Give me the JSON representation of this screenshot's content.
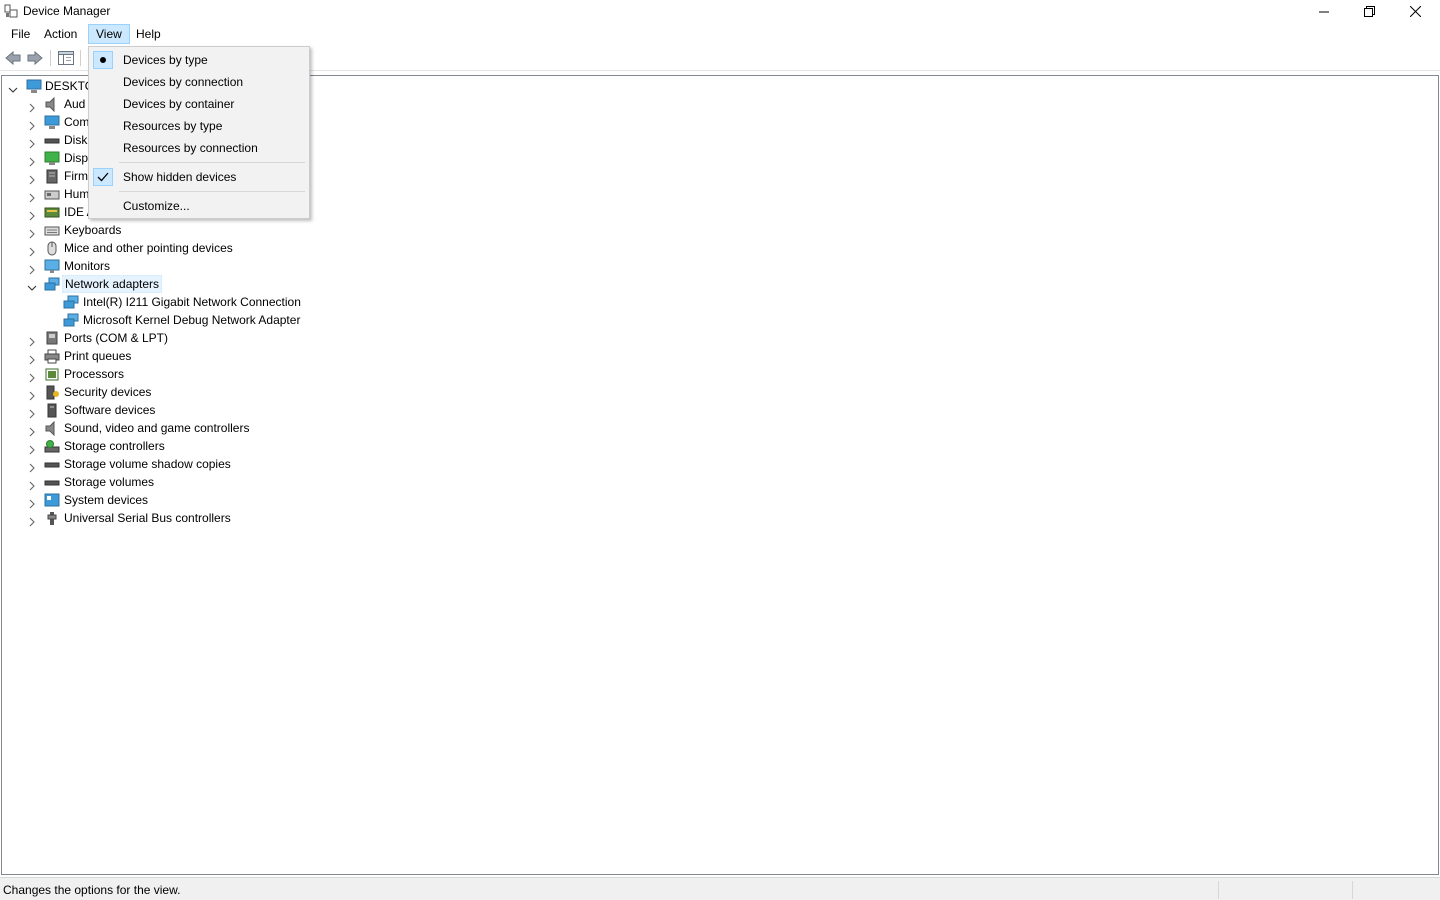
{
  "window": {
    "title": "Device Manager",
    "icon": "device-manager-icon"
  },
  "menubar": {
    "items": [
      "File",
      "Action",
      "View",
      "Help"
    ],
    "active": "View"
  },
  "view_menu": {
    "items": [
      {
        "label": "Devices by type",
        "mark": "radio"
      },
      {
        "label": "Devices by connection",
        "mark": ""
      },
      {
        "label": "Devices by container",
        "mark": ""
      },
      {
        "label": "Resources by type",
        "mark": ""
      },
      {
        "label": "Resources by connection",
        "mark": ""
      },
      {
        "label": "Show hidden devices",
        "mark": "check"
      },
      {
        "label": "Customize...",
        "mark": ""
      }
    ]
  },
  "tree": {
    "root": "DESKTO",
    "categories": [
      {
        "label": "Aud",
        "icon": "speaker-icon"
      },
      {
        "label": "Com",
        "icon": "computer-icon"
      },
      {
        "label": "Disk",
        "icon": "disk-icon"
      },
      {
        "label": "Disp",
        "icon": "display-adapter-icon"
      },
      {
        "label": "Firm",
        "icon": "firmware-icon"
      },
      {
        "label": "Hum",
        "icon": "hid-icon"
      },
      {
        "label": "IDE A",
        "icon": "ide-icon"
      },
      {
        "label": "Keyboards",
        "icon": "keyboard-icon"
      },
      {
        "label": "Mice and other pointing devices",
        "icon": "mouse-icon"
      },
      {
        "label": "Monitors",
        "icon": "monitor-icon"
      },
      {
        "label": "Network adapters",
        "icon": "network-icon"
      },
      {
        "label": "Ports (COM & LPT)",
        "icon": "port-icon"
      },
      {
        "label": "Print queues",
        "icon": "printer-icon"
      },
      {
        "label": "Processors",
        "icon": "processor-icon"
      },
      {
        "label": "Security devices",
        "icon": "security-icon"
      },
      {
        "label": "Software devices",
        "icon": "software-icon"
      },
      {
        "label": "Sound, video and game controllers",
        "icon": "speaker-icon"
      },
      {
        "label": "Storage controllers",
        "icon": "storage-controller-icon"
      },
      {
        "label": "Storage volume shadow copies",
        "icon": "disk-icon"
      },
      {
        "label": "Storage volumes",
        "icon": "disk-icon"
      },
      {
        "label": "System devices",
        "icon": "system-icon"
      },
      {
        "label": "Universal Serial Bus controllers",
        "icon": "usb-icon"
      }
    ],
    "network_children": [
      "Intel(R) I211 Gigabit Network Connection",
      "Microsoft Kernel Debug Network Adapter"
    ]
  },
  "statusbar": {
    "text": "Changes the options for the view."
  }
}
